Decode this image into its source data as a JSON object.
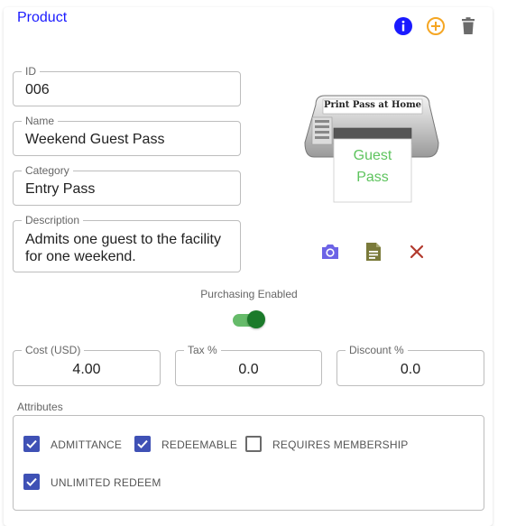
{
  "card": {
    "title": "Product"
  },
  "header_icons": [
    "info-icon",
    "add-circle-icon",
    "delete-icon"
  ],
  "fields": {
    "id": {
      "label": "ID",
      "value": "006"
    },
    "name": {
      "label": "Name",
      "value": "Weekend Guest Pass"
    },
    "category": {
      "label": "Category",
      "value": "Entry Pass"
    },
    "description": {
      "label": "Description",
      "line1": "Admits one guest to the facility",
      "line2": "for one weekend."
    }
  },
  "image": {
    "banner": "Print Pass at Home",
    "paper_line1": "Guest",
    "paper_line2": "Pass"
  },
  "image_actions": [
    "camera-icon",
    "document-icon",
    "close-icon"
  ],
  "purchasing": {
    "label": "Purchasing Enabled",
    "enabled": true
  },
  "pricing": {
    "cost": {
      "label": "Cost (USD)",
      "value": "4.00"
    },
    "tax": {
      "label": "Tax %",
      "value": "0.0"
    },
    "discount": {
      "label": "Discount %",
      "value": "0.0"
    }
  },
  "attributes": {
    "title": "Attributes",
    "items": [
      {
        "label": "ADMITTANCE",
        "checked": true
      },
      {
        "label": "REDEEMABLE",
        "checked": true
      },
      {
        "label": "REQUIRES MEMBERSHIP",
        "checked": false
      },
      {
        "label": "UNLIMITED REDEEM",
        "checked": true
      }
    ]
  },
  "colors": {
    "title": "#1a1aff",
    "info": "#1a1aff",
    "add": "#f5a623",
    "camera": "#6c63e6",
    "document": "#7a7a3a",
    "close": "#b23a2e",
    "toggle": "#1b7a2a",
    "checkbox": "#3f51b5"
  }
}
